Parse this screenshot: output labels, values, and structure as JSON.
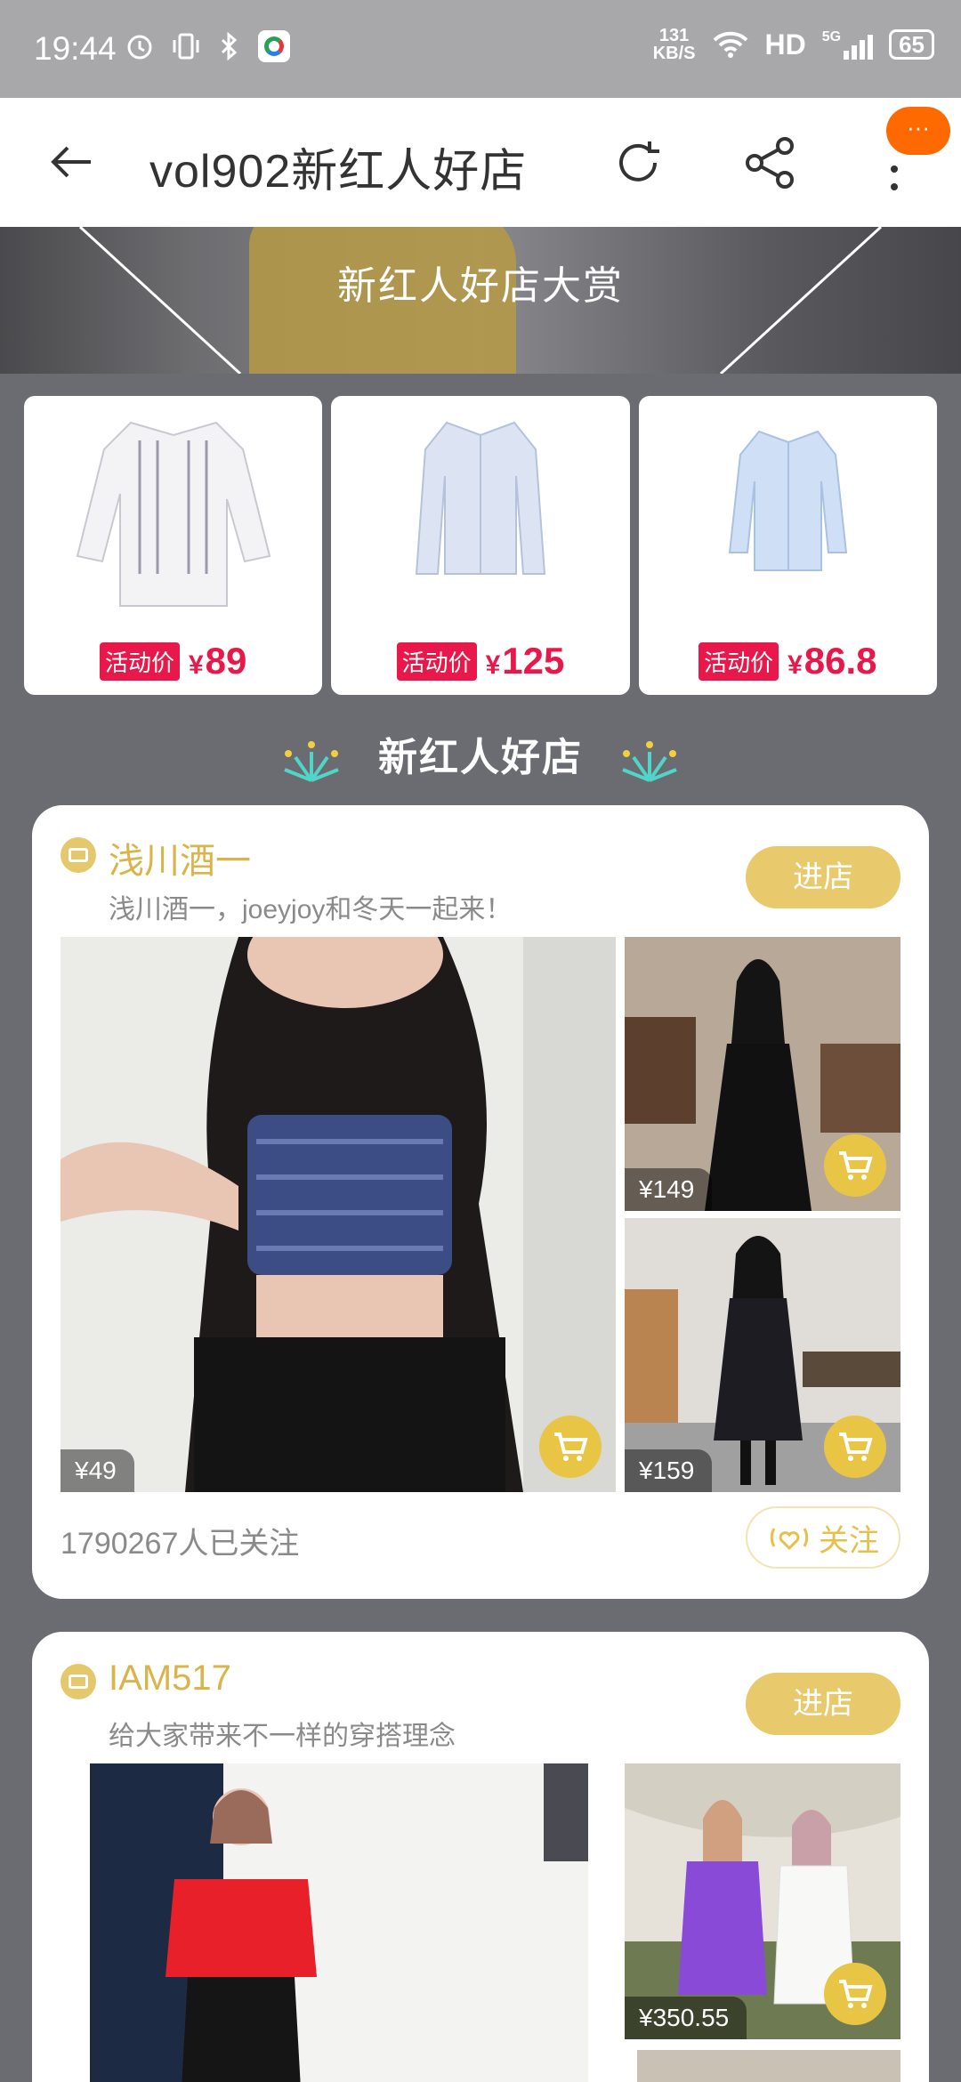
{
  "status_bar": {
    "time": "19:44",
    "net_speed": "131",
    "net_unit": "KB/S",
    "hd": "HD",
    "network": "5G",
    "battery": "65"
  },
  "nav": {
    "title": "vol902新红人好店",
    "badge": "···"
  },
  "banner": {
    "text": "新红人好店大赏"
  },
  "products": [
    {
      "tag": "活动价",
      "currency": "¥",
      "price": "89"
    },
    {
      "tag": "活动价",
      "currency": "¥",
      "price": "125"
    },
    {
      "tag": "活动价",
      "currency": "¥",
      "price": "86.8"
    }
  ],
  "section_title": "新红人好店",
  "stores": [
    {
      "name": "浅川酒一",
      "desc": "浅川酒一，joeyjoy和冬天一起来！",
      "enter_label": "进店",
      "items": [
        {
          "price": "¥49"
        },
        {
          "price": "¥149"
        },
        {
          "price": "¥159"
        }
      ],
      "followers": "1790267人已关注",
      "follow_label": "关注"
    },
    {
      "name": "IAM517",
      "desc": "给大家带来不一样的穿搭理念",
      "enter_label": "进店",
      "items": [
        {
          "price": "¥350.55"
        }
      ]
    }
  ],
  "colors": {
    "accent": "#e8c96c",
    "price_red": "#e8194a",
    "badge": "#ff6a00"
  }
}
